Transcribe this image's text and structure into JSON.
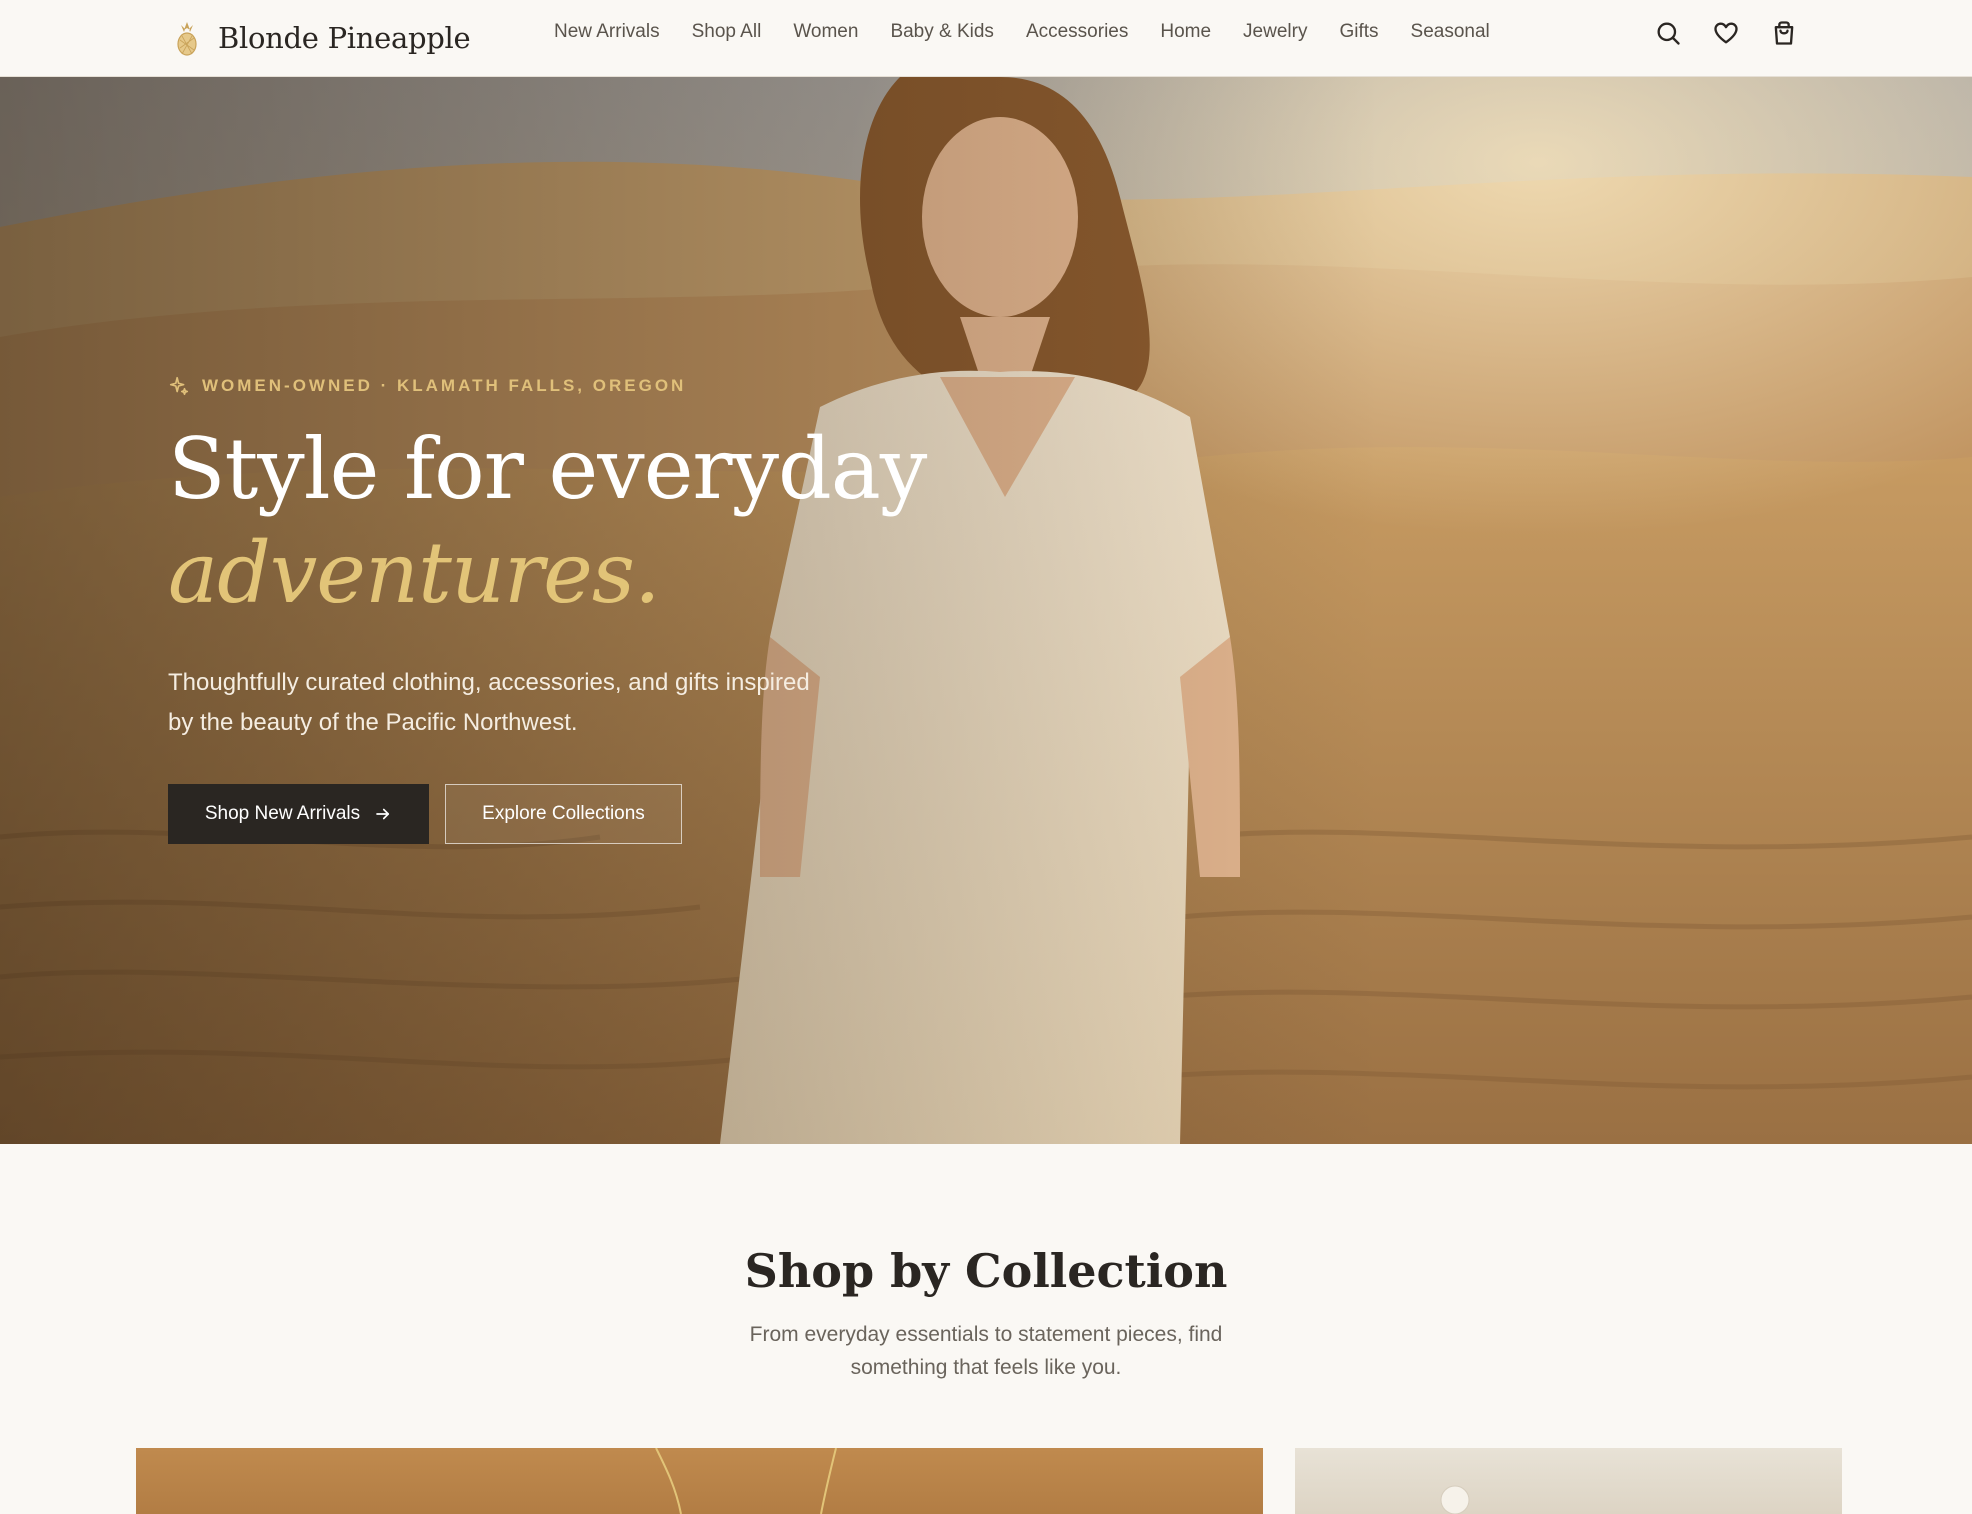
{
  "header": {
    "brand_name": "Blonde Pineapple",
    "brand_icon": "pineapple-logo",
    "nav": [
      {
        "label": "New Arrivals"
      },
      {
        "label": "Shop All"
      },
      {
        "label": "Women"
      },
      {
        "label": "Baby & Kids"
      },
      {
        "label": "Accessories"
      },
      {
        "label": "Home"
      },
      {
        "label": "Jewelry"
      },
      {
        "label": "Gifts"
      },
      {
        "label": "Seasonal"
      }
    ],
    "icons": [
      "search-icon",
      "heart-icon",
      "shopping-bag-icon"
    ]
  },
  "hero": {
    "eyebrow": "WOMEN-OWNED · KLAMATH FALLS, OREGON",
    "eyebrow_icon": "sparkle-icon",
    "title_line1": "Style for everyday",
    "title_line2": "adventures.",
    "subtitle": "Thoughtfully curated clothing, accessories, and gifts inspired by the beauty of the Pacific Northwest.",
    "primary_cta": "Shop New Arrivals",
    "secondary_cta": "Explore Collections"
  },
  "collections": {
    "title": "Shop by Collection",
    "subtitle": "From everyday essentials to statement pieces, find something that feels like you."
  },
  "colors": {
    "background": "#faf8f4",
    "text_dark": "#2a2622",
    "accent_gold": "#e2c478",
    "button_dark": "#2a2622"
  }
}
